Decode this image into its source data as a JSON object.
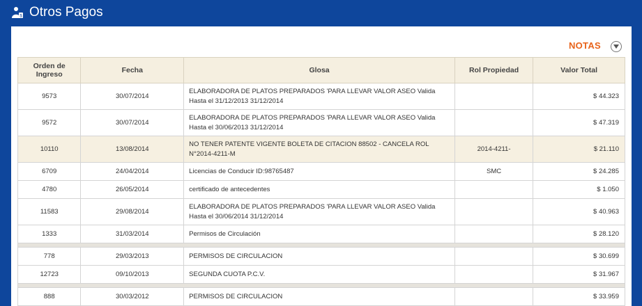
{
  "header": {
    "title": "Otros Pagos",
    "icon": "money-user-icon"
  },
  "notes": {
    "label": "NOTAS",
    "toggle_icon": "chevron-down-circle-icon"
  },
  "table": {
    "headers": {
      "orden_line1": "Orden de",
      "orden_line2": "Ingreso",
      "fecha": "Fecha",
      "glosa": "Glosa",
      "rol": "Rol Propiedad",
      "valor": "Valor Total"
    },
    "rows": [
      {
        "orden": "9573",
        "fecha": "30/07/2014",
        "glosa": "ELABORADORA DE PLATOS PREPARADOS 'PARA LLEVAR VALOR ASEO Valida Hasta el 31/12/2013 31/12/2014",
        "rol": "",
        "valor": "$ 44.323"
      },
      {
        "orden": "9572",
        "fecha": "30/07/2014",
        "glosa": "ELABORADORA DE PLATOS PREPARADOS 'PARA LLEVAR VALOR ASEO Valida Hasta el 30/06/2013 31/12/2014",
        "rol": "",
        "valor": "$ 47.319"
      },
      {
        "orden": "10110",
        "fecha": "13/08/2014",
        "glosa": "NO TENER PATENTE VIGENTE BOLETA DE CITACION 88502 - CANCELA ROL N°2014-4211-M",
        "rol": "2014-4211-",
        "valor": "$ 21.110"
      },
      {
        "orden": "6709",
        "fecha": "24/04/2014",
        "glosa": "Licencias de Conducir ID:98765487",
        "rol": "SMC",
        "valor": "$ 24.285"
      },
      {
        "orden": "4780",
        "fecha": "26/05/2014",
        "glosa": "certificado de antecedentes",
        "rol": "",
        "valor": "$ 1.050"
      },
      {
        "orden": "11583",
        "fecha": "29/08/2014",
        "glosa": "ELABORADORA DE PLATOS PREPARADOS 'PARA LLEVAR VALOR ASEO Valida Hasta el 30/06/2014 31/12/2014",
        "rol": "",
        "valor": "$ 40.963"
      },
      {
        "orden": "1333",
        "fecha": "31/03/2014",
        "glosa": "Permisos de Circulación",
        "rol": "",
        "valor": "$ 28.120"
      },
      {
        "orden": "778",
        "fecha": "29/03/2013",
        "glosa": "PERMISOS DE CIRCULACION",
        "rol": "",
        "valor": "$ 30.699"
      },
      {
        "orden": "12723",
        "fecha": "09/10/2013",
        "glosa": "SEGUNDA CUOTA P.C.V.",
        "rol": "",
        "valor": "$ 31.967"
      },
      {
        "orden": "888",
        "fecha": "30/03/2012",
        "glosa": "PERMISOS DE CIRCULACION",
        "rol": "",
        "valor": "$ 33.959"
      }
    ]
  },
  "colors": {
    "header_bg": "#0e469c",
    "accent": "#e8631a",
    "table_header_bg": "#f5efe0",
    "highlight_row": "#f6f0e1"
  }
}
